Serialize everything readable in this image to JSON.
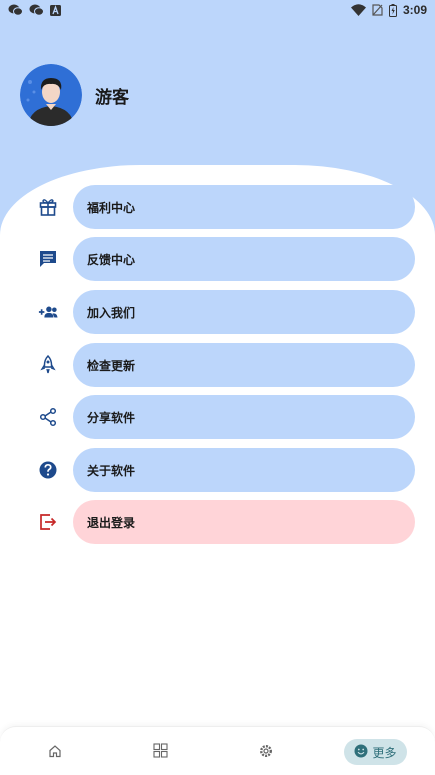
{
  "status_bar": {
    "time": "3:09",
    "left_icons": [
      "wechat-icon",
      "wechat-icon",
      "app-a-icon"
    ],
    "right_icons": [
      "wifi-icon",
      "sim-icon",
      "battery-icon"
    ]
  },
  "profile": {
    "username": "游客",
    "avatar": "avatar-icon"
  },
  "menu": [
    {
      "label": "福利中心",
      "icon": "gift-icon",
      "style": "normal"
    },
    {
      "label": "反馈中心",
      "icon": "feedback-icon",
      "style": "normal"
    },
    {
      "label": "加入我们",
      "icon": "group-add-icon",
      "style": "normal"
    },
    {
      "label": "检查更新",
      "icon": "rocket-icon",
      "style": "normal"
    },
    {
      "label": "分享软件",
      "icon": "share-icon",
      "style": "normal"
    },
    {
      "label": "关于软件",
      "icon": "help-icon",
      "style": "normal"
    },
    {
      "label": "退出登录",
      "icon": "logout-icon",
      "style": "danger"
    }
  ],
  "bottom_nav": {
    "items": [
      {
        "icon": "home-icon"
      },
      {
        "icon": "grid-icon"
      },
      {
        "icon": "settings-icon"
      },
      {
        "icon": "smile-icon",
        "label": "更多",
        "active": true
      }
    ]
  },
  "colors": {
    "header_bg": "#bcd6fb",
    "pill_bg": "#bcd6fb",
    "danger_pill_bg": "#ffd4d8",
    "icon_blue": "#1e4a8c",
    "icon_red": "#c62828",
    "nav_active_bg": "#cfe3e8",
    "nav_active_text": "#2f6f7a"
  }
}
